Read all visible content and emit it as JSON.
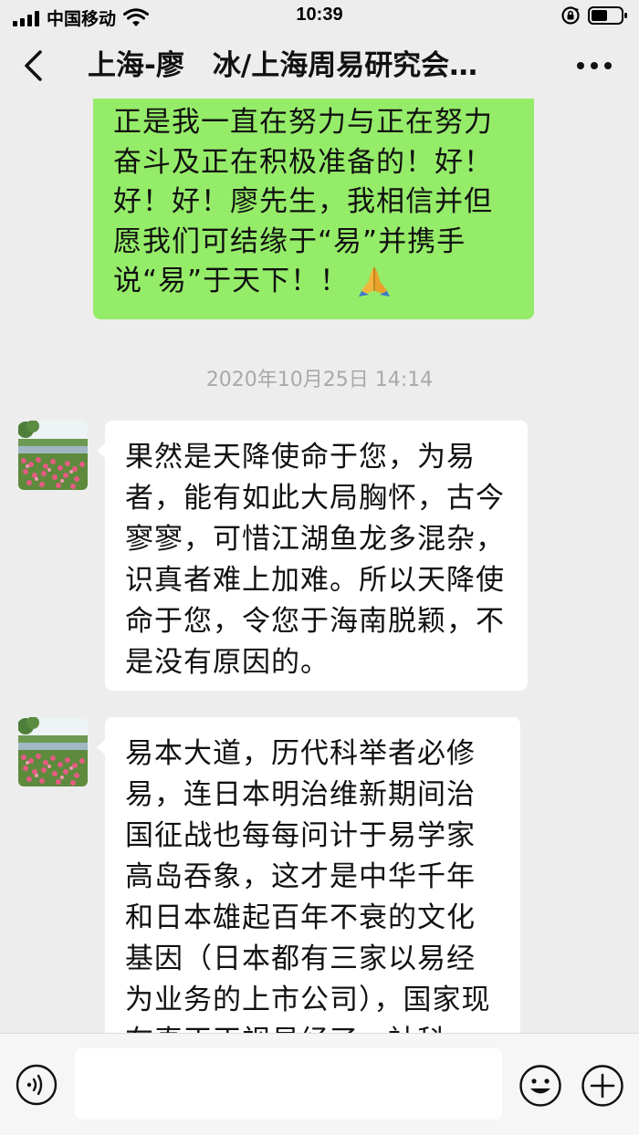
{
  "status_bar": {
    "carrier": "中国移动",
    "time": "10:39",
    "icons": [
      "signal-icon",
      "wifi-icon",
      "rotation-lock-icon",
      "battery-icon"
    ]
  },
  "nav": {
    "title": "上海-廖　冰/上海周易研究会…",
    "back_icon": "chevron-left-icon",
    "more_icon": "more-dots-icon"
  },
  "messages": {
    "outgoing": {
      "text": "正是我一直在努力与正在努力奋斗及正在积极准备的！好！好！好！廖先生，我相信并但愿我们可结缘于“易”并携手说“易”于天下！！",
      "emoji": "folded-hands-icon",
      "bubble_color": "#95ec69"
    },
    "timestamp": "2020年10月25日 14:14",
    "incoming": [
      {
        "avatar": "landscape-flowers-avatar",
        "text": "果然是天降使命于您，为易者，能有如此大局胸怀，古今寥寥，可惜江湖鱼龙多混杂，识真者难上加难。所以天降使命于您，令您于海南脱颖，不是没有原因的。"
      },
      {
        "avatar": "landscape-flowers-avatar",
        "text": "易本大道，历代科举者必修易，连日本明治维新期间治国征战也每每问计于易学家高岛吞象，这才是中华千年和日本雄起百年不衰的文化基因（日本都有三家以易经为业务的上市公司），国家现在真正正视易经了，社科"
      }
    ]
  },
  "input_bar": {
    "voice_icon": "voice-icon",
    "emoji_icon": "emoji-face-icon",
    "plus_icon": "plus-circle-icon",
    "placeholder": ""
  },
  "colors": {
    "background": "#ededed",
    "outgoing_bubble": "#95ec69",
    "incoming_bubble": "#ffffff",
    "timestamp_text": "#a9a9a9"
  }
}
